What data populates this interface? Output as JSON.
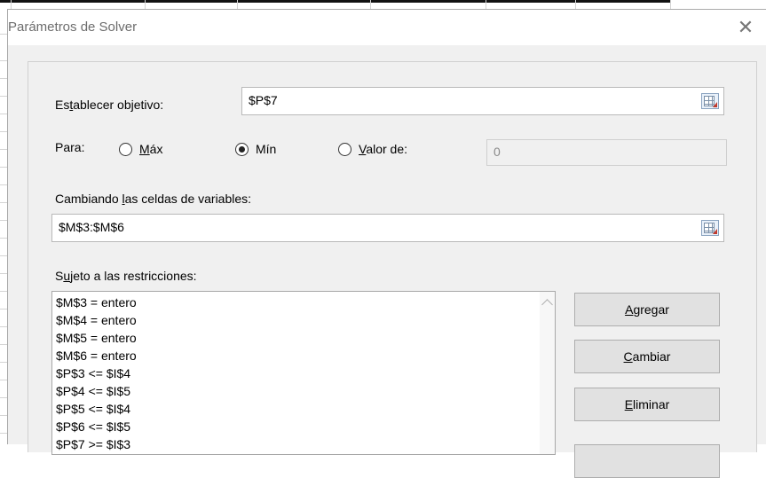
{
  "dialog": {
    "title": "Parámetros de Solver"
  },
  "objective": {
    "label_pre": "Es",
    "label_u": "t",
    "label_post": "ablecer objetivo:",
    "value": "$P$7"
  },
  "para": {
    "label": "Para:",
    "options": [
      {
        "pre": "",
        "u": "M",
        "post": "áx",
        "selected": false
      },
      {
        "pre": "",
        "u": "",
        "post": "Mín",
        "selected": true
      },
      {
        "pre": "",
        "u": "V",
        "post": "alor de:",
        "selected": false
      }
    ],
    "value_of": "0"
  },
  "variables": {
    "label_pre": "Cambiando ",
    "label_u": "l",
    "label_post": "as celdas de variables:",
    "value": "$M$3:$M$6"
  },
  "constraints": {
    "label_pre": "S",
    "label_u": "u",
    "label_post": "jeto a las restricciones:",
    "items": [
      "$M$3 = entero",
      "$M$4 = entero",
      "$M$5 = entero",
      "$M$6 = entero",
      "$P$3 <= $I$4",
      "$P$4 <= $I$5",
      "$P$5 <= $I$4",
      "$P$6 <= $I$5",
      "$P$7 >= $I$3"
    ]
  },
  "buttons": {
    "add": {
      "u": "A",
      "post": "gregar"
    },
    "change": {
      "u": "C",
      "post": "ambiar"
    },
    "delete": {
      "u": "E",
      "post": "liminar"
    }
  }
}
